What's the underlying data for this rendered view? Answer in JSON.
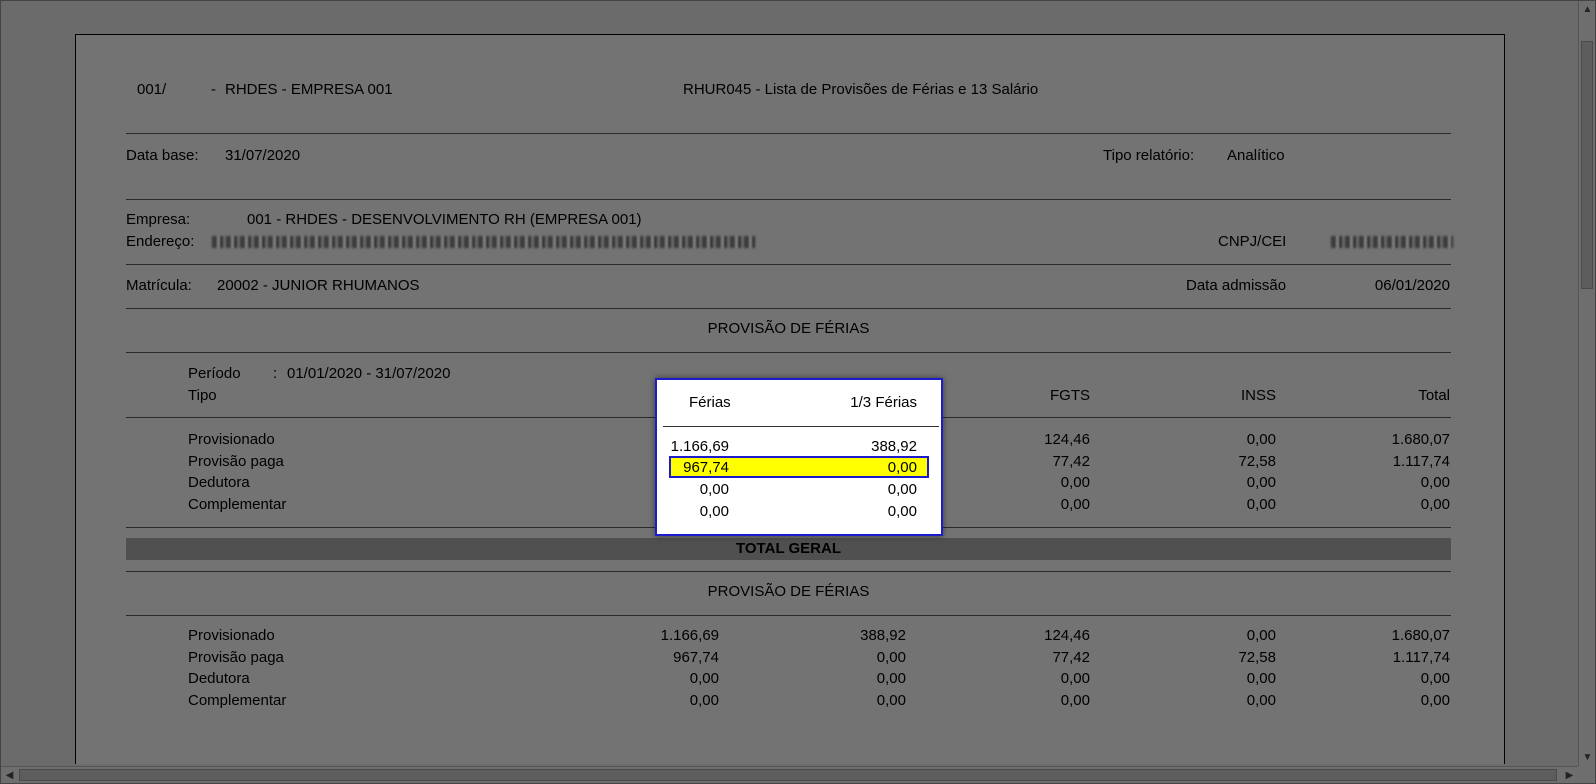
{
  "header": {
    "company_code": "001/",
    "company_dash": "-",
    "company_name": "RHDES - EMPRESA 001",
    "report_title": "RHUR045 - Lista de Provisões de Férias e 13 Salário"
  },
  "base": {
    "date_label": "Data base:",
    "date_value": "31/07/2020",
    "type_label": "Tipo relatório:",
    "type_value": "Analítico"
  },
  "company": {
    "empresa_label": "Empresa:",
    "empresa_value": "001 - RHDES - DESENVOLVIMENTO RH (EMPRESA 001)",
    "endereco_label": "Endereço:",
    "cnpj_label": "CNPJ/CEI"
  },
  "employee": {
    "matricula_label": "Matrícula:",
    "matricula_value": "20002 - JUNIOR RHUMANOS",
    "admission_label": "Data admissão",
    "admission_value": "06/01/2020"
  },
  "section1": {
    "title": "PROVISÃO DE FÉRIAS",
    "periodo_label": "Período",
    "periodo_sep": ":",
    "periodo_value": "01/01/2020 - 31/07/2020",
    "tipo_label": "Tipo",
    "columns": [
      "Férias",
      "1/3 Férias",
      "FGTS",
      "INSS",
      "Total"
    ],
    "rows": [
      {
        "label": "Provisionado",
        "values": [
          "1.166,69",
          "388,92",
          "124,46",
          "0,00",
          "1.680,07"
        ]
      },
      {
        "label": "Provisão paga",
        "values": [
          "967,74",
          "0,00",
          "77,42",
          "72,58",
          "1.117,74"
        ]
      },
      {
        "label": "Dedutora",
        "values": [
          "0,00",
          "0,00",
          "0,00",
          "0,00",
          "0,00"
        ]
      },
      {
        "label": "Complementar",
        "values": [
          "0,00",
          "0,00",
          "0,00",
          "0,00",
          "0,00"
        ]
      }
    ]
  },
  "total_geral": "TOTAL GERAL",
  "section2": {
    "title": "PROVISÃO DE FÉRIAS",
    "rows": [
      {
        "label": "Provisionado",
        "values": [
          "1.166,69",
          "388,92",
          "124,46",
          "0,00",
          "1.680,07"
        ]
      },
      {
        "label": "Provisão paga",
        "values": [
          "967,74",
          "0,00",
          "77,42",
          "72,58",
          "1.117,74"
        ]
      },
      {
        "label": "Dedutora",
        "values": [
          "0,00",
          "0,00",
          "0,00",
          "0,00",
          "0,00"
        ]
      },
      {
        "label": "Complementar",
        "values": [
          "0,00",
          "0,00",
          "0,00",
          "0,00",
          "0,00"
        ]
      }
    ]
  },
  "colors": {
    "highlight_border": "#1c1ccc",
    "highlight_fill": "#ffff00"
  },
  "icons": {
    "scroll_up": "scroll-up-icon",
    "scroll_down": "scroll-down-icon",
    "scroll_left": "scroll-left-icon",
    "scroll_right": "scroll-right-icon"
  }
}
